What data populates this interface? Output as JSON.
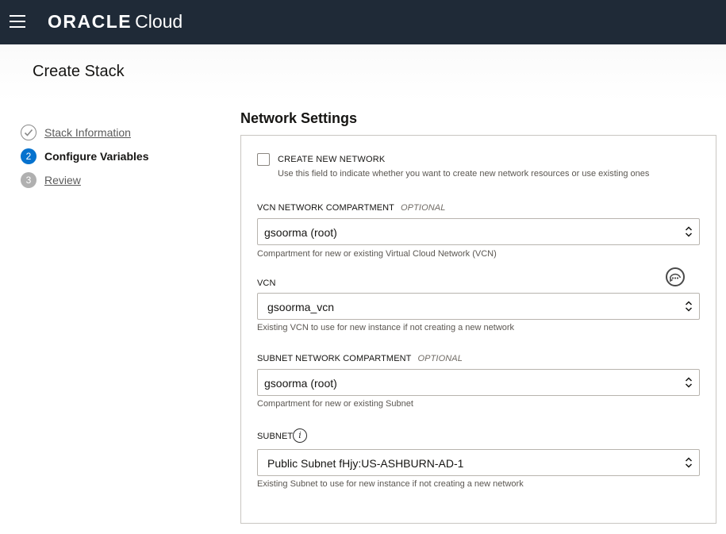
{
  "header": {
    "brand_oracle": "ORACLE",
    "brand_cloud": "Cloud",
    "menu_icon": "hamburger-menu-icon"
  },
  "page": {
    "title": "Create Stack"
  },
  "steps": [
    {
      "number": "",
      "label": "Stack Information",
      "state": "done",
      "icon": "checkmark-icon"
    },
    {
      "number": "2",
      "label": "Configure Variables",
      "state": "active"
    },
    {
      "number": "3",
      "label": "Review",
      "state": "future"
    }
  ],
  "section": {
    "title": "Network Settings"
  },
  "create_network": {
    "label": "CREATE NEW NETWORK",
    "checked": false,
    "help": "Use this field to indicate whether you want to create new network resources or use existing ones"
  },
  "fields": {
    "vcn_compartment": {
      "label": "VCN NETWORK COMPARTMENT",
      "optional": "OPTIONAL",
      "value": "gsoorma (root)",
      "help": "Compartment for new or existing Virtual Cloud Network (VCN)"
    },
    "vcn": {
      "label": "VCN",
      "value": "gsoorma_vcn",
      "help": "Existing VCN to use for new instance if not creating a new network"
    },
    "subnet_compartment": {
      "label": "SUBNET NETWORK COMPARTMENT",
      "optional": "OPTIONAL",
      "value": "gsoorma (root)",
      "help": "Compartment for new or existing Subnet"
    },
    "subnet": {
      "label": "SUBNET",
      "info_icon": "info-icon",
      "value": "Public Subnet fHjy:US-ASHBURN-AD-1",
      "help": "Existing Subnet to use for new instance if not creating a new network"
    }
  },
  "floating": {
    "chat_icon": "chat-bubble-icon"
  },
  "colors": {
    "topbar": "#1f2a37",
    "step_active": "#0572ce",
    "step_future": "#b0b0b0"
  }
}
